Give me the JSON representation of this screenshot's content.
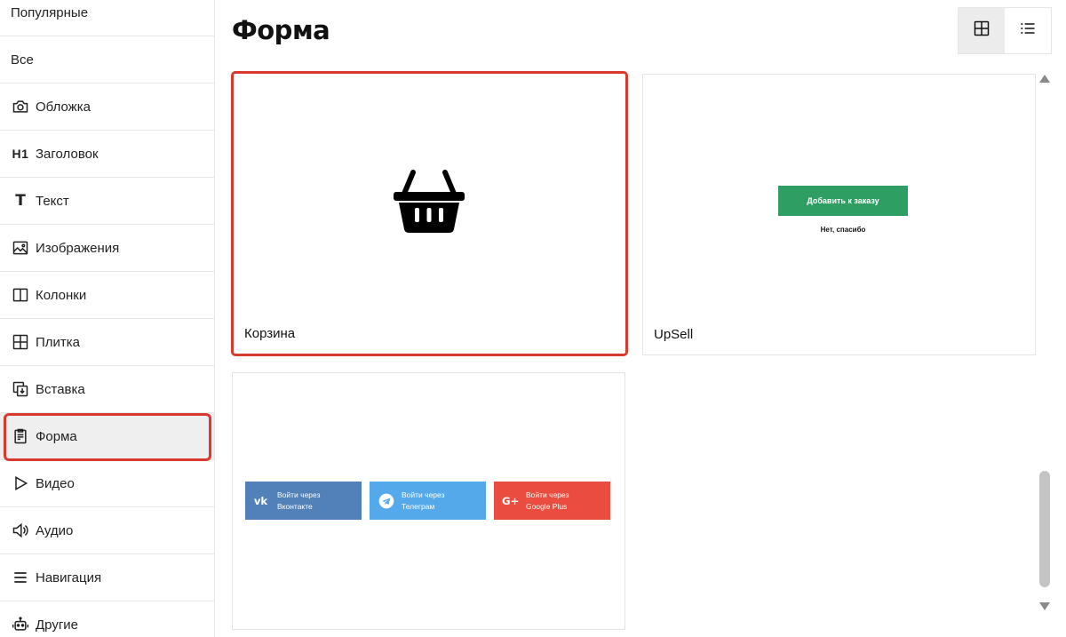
{
  "sidebar": {
    "items": [
      {
        "label": "Популярные",
        "icon": "none"
      },
      {
        "label": "Все",
        "icon": "none"
      },
      {
        "label": "Обложка",
        "icon": "camera-icon"
      },
      {
        "label": "Заголовок",
        "icon": "h1-icon",
        "icon_text": "H1"
      },
      {
        "label": "Текст",
        "icon": "text-icon",
        "icon_text": "T"
      },
      {
        "label": "Изображения",
        "icon": "image-icon"
      },
      {
        "label": "Колонки",
        "icon": "columns-icon"
      },
      {
        "label": "Плитка",
        "icon": "tiles-icon"
      },
      {
        "label": "Вставка",
        "icon": "insert-icon"
      },
      {
        "label": "Форма",
        "icon": "form-icon",
        "active": true
      },
      {
        "label": "Видео",
        "icon": "play-icon"
      },
      {
        "label": "Аудио",
        "icon": "speaker-icon"
      },
      {
        "label": "Навигация",
        "icon": "menu-icon"
      },
      {
        "label": "Другие",
        "icon": "robot-icon"
      }
    ]
  },
  "main": {
    "title": "Форма",
    "view_toggle": {
      "active": "grid",
      "options": [
        "grid-icon",
        "list-icon"
      ]
    },
    "cards": [
      {
        "label": "Корзина",
        "preview_icon": "basket-icon",
        "selected": true
      },
      {
        "label": "UpSell",
        "preview": {
          "button": "Добавить к заказу",
          "decline": "Нет, спасибо"
        }
      },
      {
        "label": "",
        "preview": {
          "buttons": [
            {
              "line1": "Войти через",
              "line2": "Вконтакте",
              "color": "#5181b8",
              "icon": "vk-icon"
            },
            {
              "line1": "Войти через",
              "line2": "Телеграм",
              "color": "#54a9eb",
              "icon": "telegram-icon"
            },
            {
              "line1": "Войти через",
              "line2": "Google Plus",
              "color": "#ea4c3f",
              "icon": "google-plus-icon"
            }
          ]
        }
      }
    ]
  },
  "colors": {
    "accent_outline": "#d93a2e",
    "upsell_green": "#2e9e63"
  }
}
